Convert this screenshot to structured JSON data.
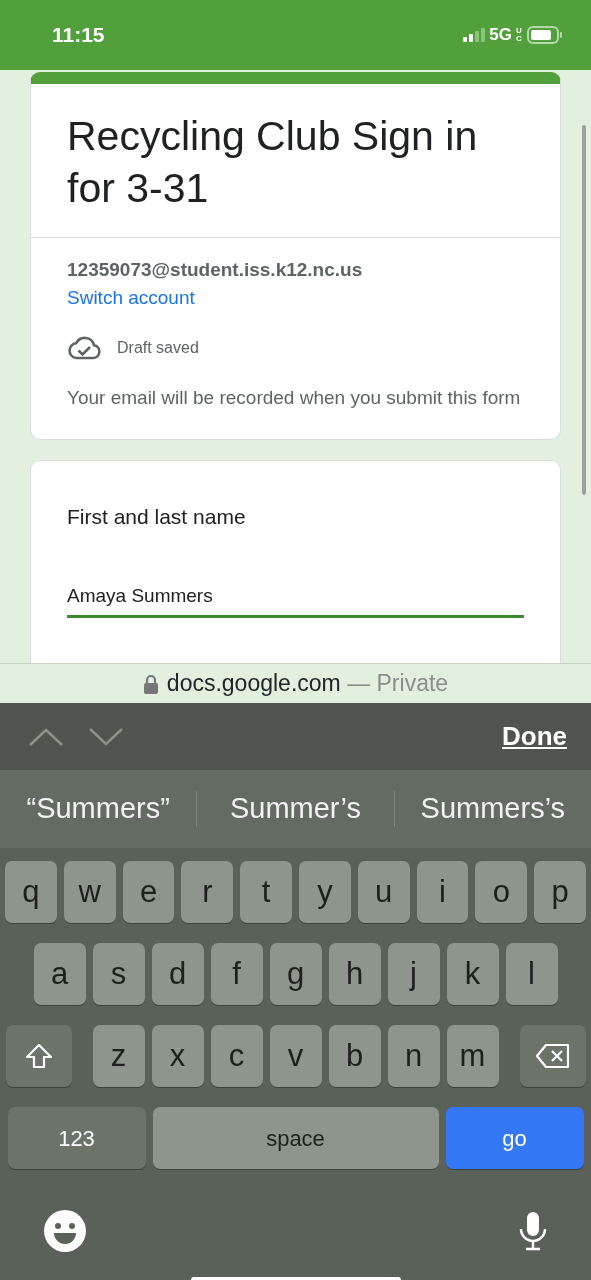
{
  "status_bar": {
    "time": "11:15",
    "network": "5G",
    "network_suffix": "UC"
  },
  "form": {
    "title": "Recycling Club Sign in for 3-31",
    "account_email": "12359073@student.iss.k12.nc.us",
    "switch_account": "Switch account",
    "draft_status": "Draft saved",
    "notice": "Your email will be recorded when you submit this form"
  },
  "questions": [
    {
      "label": "First and last name",
      "value": "Amaya Summers",
      "focused": true
    }
  ],
  "address_bar": {
    "domain": "docs.google.com",
    "suffix": "— Private"
  },
  "form_toolbar": {
    "done": "Done"
  },
  "suggestions": [
    "“Summers”",
    "Summer’s",
    "Summers’s"
  ],
  "keyboard": {
    "rows": [
      [
        "q",
        "w",
        "e",
        "r",
        "t",
        "y",
        "u",
        "i",
        "o",
        "p"
      ],
      [
        "a",
        "s",
        "d",
        "f",
        "g",
        "h",
        "j",
        "k",
        "l"
      ],
      [
        "z",
        "x",
        "c",
        "v",
        "b",
        "n",
        "m"
      ]
    ],
    "numbers_key": "123",
    "space_key": "space",
    "return_key": "go"
  }
}
